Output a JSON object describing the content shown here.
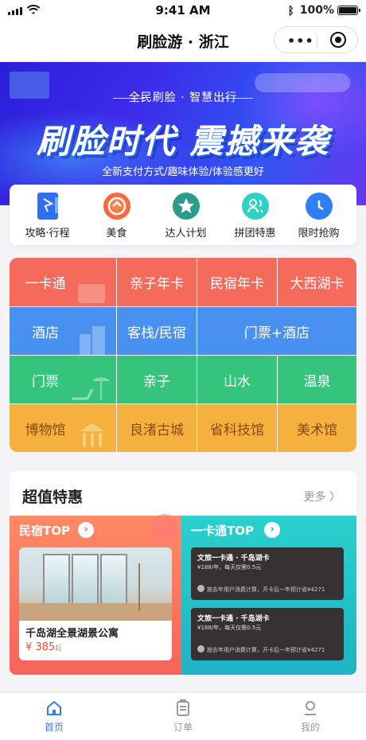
{
  "status_bar": {
    "time": "9:41 AM",
    "battery": "100%"
  },
  "nav": {
    "title": "刷脸游 · 浙江",
    "more": "•••"
  },
  "banner": {
    "tagline": "全民刷脸 · 智慧出行",
    "headline": "刷脸时代  震撼来袭",
    "subline": "全新支付方式/趣味体验/体验感更好"
  },
  "quick_menu": [
    {
      "label": "攻略·行程",
      "icon": "bookmark-icon",
      "color": "#2f6ff2"
    },
    {
      "label": "美食",
      "icon": "food-icon",
      "color": "#f0542f"
    },
    {
      "label": "达人计划",
      "icon": "star-badge-icon",
      "color": "#2a9c8a"
    },
    {
      "label": "拼团特惠",
      "icon": "group-icon",
      "color": "#2fd1c6"
    },
    {
      "label": "限时抢购",
      "icon": "stopwatch-icon",
      "color": "#2f7ff2"
    }
  ],
  "categories": {
    "row1": [
      "一卡通",
      "亲子年卡",
      "民宿年卡",
      "大西湖卡"
    ],
    "row2": [
      "酒店",
      "客栈/民宿",
      "门票+酒店"
    ],
    "row3": [
      "门票",
      "亲子",
      "山水",
      "温泉"
    ],
    "row4": [
      "博物馆",
      "良渚古城",
      "省科技馆",
      "美术馆"
    ]
  },
  "deals": {
    "title": "超值特惠",
    "more": "更多 〉",
    "homestay": {
      "title": "民宿TOP",
      "name": "千岛湖全景湖景公寓",
      "price": "¥ 385",
      "price_unit": "起"
    },
    "card_top": {
      "title": "一卡通TOP",
      "cards": [
        {
          "name": "文旅一卡通 · 千岛湖卡",
          "desc": "¥188/年，每天仅需0.5元",
          "note": "按去年用户消费计算，开卡后一年预计省¥4271"
        },
        {
          "name": "文旅一卡通 · 千岛湖卡",
          "desc": "¥188/年，每天仅需0.5元",
          "note": "按去年用户消费计算，开卡后一年预计省¥4271"
        }
      ]
    }
  },
  "tabbar": [
    {
      "label": "首页",
      "icon": "home-icon",
      "active": true
    },
    {
      "label": "订单",
      "icon": "order-icon",
      "active": false
    },
    {
      "label": "我的",
      "icon": "profile-icon",
      "active": false
    }
  ],
  "colors": {
    "accent": "#3c7bf0",
    "row1": "#f46a5b",
    "row2": "#4891f0",
    "row3": "#35c47c",
    "row4": "#f5b13d"
  }
}
